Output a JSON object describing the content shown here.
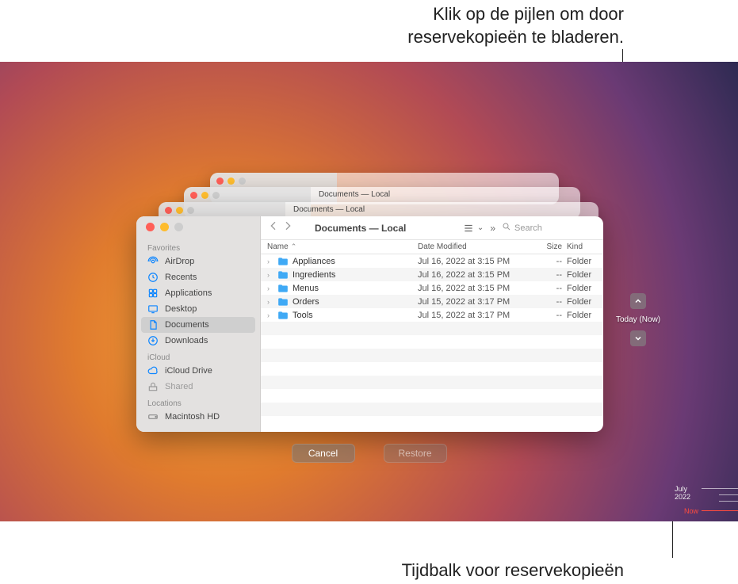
{
  "callouts": {
    "top_line1": "Klik op de pijlen om door",
    "top_line2": "reservekopieën te bladeren.",
    "bottom": "Tijdbalk voor reservekopieën"
  },
  "stacked_title": "Documents — Local",
  "window": {
    "title": "Documents — Local",
    "search_placeholder": "Search",
    "columns": {
      "name": "Name",
      "date": "Date Modified",
      "size": "Size",
      "kind": "Kind"
    },
    "sidebar": {
      "favorites_header": "Favorites",
      "icloud_header": "iCloud",
      "locations_header": "Locations",
      "items": {
        "airdrop": "AirDrop",
        "recents": "Recents",
        "applications": "Applications",
        "desktop": "Desktop",
        "documents": "Documents",
        "downloads": "Downloads",
        "icloud_drive": "iCloud Drive",
        "shared": "Shared",
        "macintosh_hd": "Macintosh HD"
      }
    },
    "rows": [
      {
        "name": "Appliances",
        "date": "Jul 16, 2022 at 3:15 PM",
        "size": "--",
        "kind": "Folder"
      },
      {
        "name": "Ingredients",
        "date": "Jul 16, 2022 at 3:15 PM",
        "size": "--",
        "kind": "Folder"
      },
      {
        "name": "Menus",
        "date": "Jul 16, 2022 at 3:15 PM",
        "size": "--",
        "kind": "Folder"
      },
      {
        "name": "Orders",
        "date": "Jul 15, 2022 at 3:17 PM",
        "size": "--",
        "kind": "Folder"
      },
      {
        "name": "Tools",
        "date": "Jul 15, 2022 at 3:17 PM",
        "size": "--",
        "kind": "Folder"
      }
    ]
  },
  "nav": {
    "current_label": "Today (Now)"
  },
  "buttons": {
    "cancel": "Cancel",
    "restore": "Restore"
  },
  "timeline": {
    "month": "July 2022",
    "now": "Now"
  }
}
